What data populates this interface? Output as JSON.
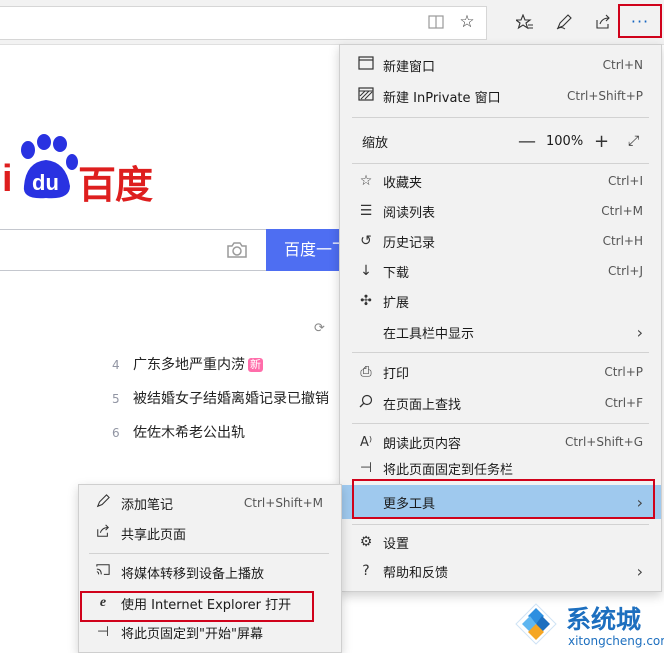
{
  "browser": {
    "toolbar_icons": [
      "reading-view-icon",
      "favorite-star-icon",
      "favorites-list-icon",
      "notes-pen-icon",
      "share-icon"
    ],
    "more_button": "···"
  },
  "baidu": {
    "logo_i": "i",
    "logo_du": "du",
    "logo_text": "百度",
    "search_button": "百度一下",
    "hot_items": [
      {
        "num": "4",
        "text": "广东多地严重内涝",
        "badge": "新"
      },
      {
        "num": "5",
        "text": "被结婚女子结婚离婚记录已撤销",
        "badge": ""
      },
      {
        "num": "6",
        "text": "佐佐木希老公出轨",
        "badge": ""
      }
    ],
    "refresh_text": "换"
  },
  "menu": {
    "new_window": {
      "label": "新建窗口",
      "shortcut": "Ctrl+N"
    },
    "new_inprivate": {
      "label": "新建 InPrivate 窗口",
      "shortcut": "Ctrl+Shift+P"
    },
    "zoom": {
      "label": "缩放",
      "minus": "—",
      "value": "100%",
      "plus": "+"
    },
    "favorites": {
      "label": "收藏夹",
      "shortcut": "Ctrl+I"
    },
    "reading_list": {
      "label": "阅读列表",
      "shortcut": "Ctrl+M"
    },
    "history": {
      "label": "历史记录",
      "shortcut": "Ctrl+H"
    },
    "downloads": {
      "label": "下载",
      "shortcut": "Ctrl+J"
    },
    "extensions": {
      "label": "扩展"
    },
    "show_in_toolbar": {
      "label": "在工具栏中显示"
    },
    "print": {
      "label": "打印",
      "shortcut": "Ctrl+P"
    },
    "find": {
      "label": "在页面上查找",
      "shortcut": "Ctrl+F"
    },
    "read_aloud": {
      "label": "朗读此页内容",
      "shortcut": "Ctrl+Shift+G"
    },
    "pin_taskbar": {
      "label": "将此页面固定到任务栏"
    },
    "more_tools": {
      "label": "更多工具"
    },
    "settings": {
      "label": "设置"
    },
    "help": {
      "label": "帮助和反馈"
    }
  },
  "submenu": {
    "add_notes": {
      "label": "添加笔记",
      "shortcut": "Ctrl+Shift+M"
    },
    "share": {
      "label": "共享此页面"
    },
    "cast": {
      "label": "将媒体转移到设备上播放"
    },
    "open_ie": {
      "label": "使用 Internet Explorer 打开"
    },
    "pin_start": {
      "label": "将此页固定到\"开始\"屏幕"
    }
  },
  "watermark": {
    "title": "系统城",
    "sub": "xitongcheng.com"
  },
  "colors": {
    "highlight": "#9fc9ee",
    "annotation_red": "#d0021b",
    "baidu_red": "#de1e1e",
    "baidu_blue": "#4e6ef2",
    "accent_blue": "#1565c0"
  }
}
